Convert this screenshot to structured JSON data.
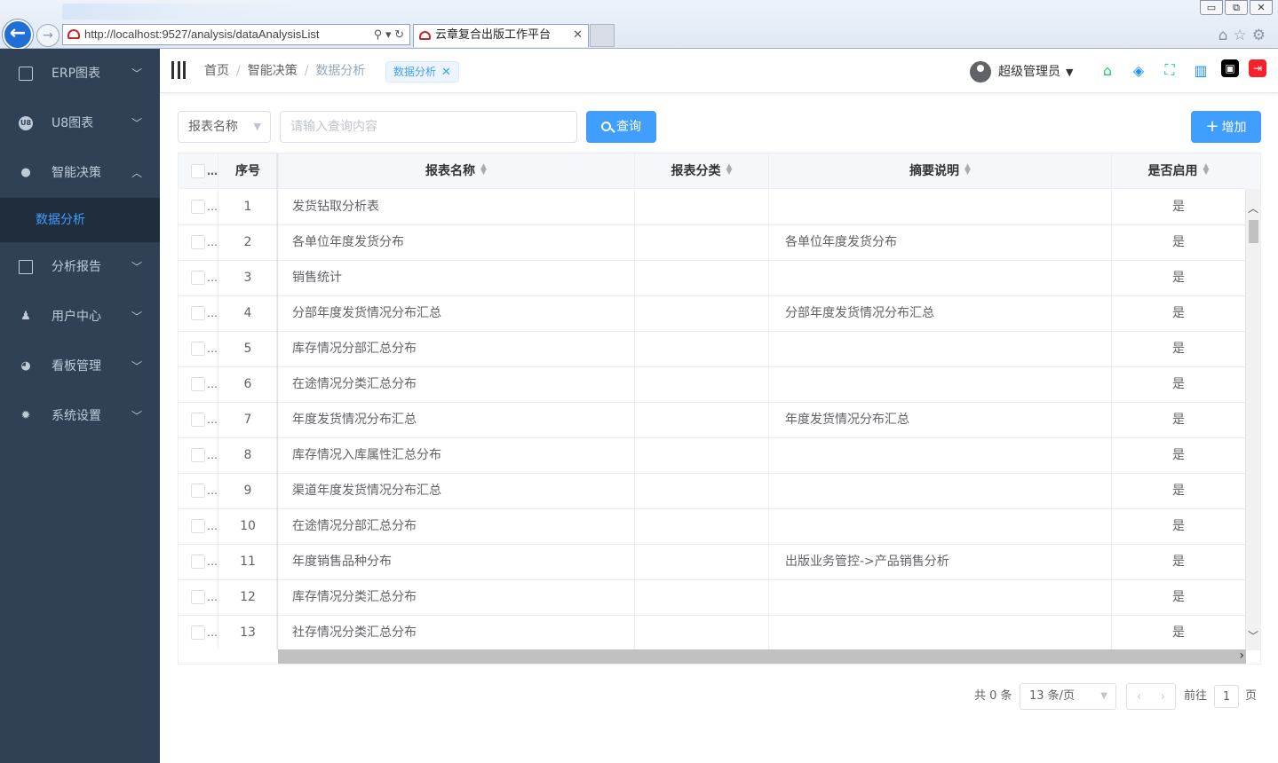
{
  "browser": {
    "url": "http://localhost:9527/analysis/dataAnalysisList",
    "tab_title": "云章复合出版工作平台",
    "tab_close": "✕",
    "win_min": "▭",
    "win_max": "⧉",
    "win_close": "✕"
  },
  "sidebar": {
    "items": [
      {
        "label": "ERP图表",
        "icon": "chart-icon",
        "expanded": false
      },
      {
        "label": "U8图表",
        "icon": "u8-icon",
        "expanded": false
      },
      {
        "label": "智能决策",
        "icon": "brain-icon",
        "expanded": true
      },
      {
        "label": "分析报告",
        "icon": "report-icon",
        "expanded": false
      },
      {
        "label": "用户中心",
        "icon": "user-icon",
        "expanded": false
      },
      {
        "label": "看板管理",
        "icon": "dashboard-icon",
        "expanded": false
      },
      {
        "label": "系统设置",
        "icon": "gear-icon",
        "expanded": false
      }
    ],
    "active_sub": "数据分析"
  },
  "navbar": {
    "breadcrumb": [
      "首页",
      "智能决策",
      "数据分析"
    ],
    "tag": "数据分析",
    "user": "超级管理员"
  },
  "filter": {
    "select_value": "报表名称",
    "search_placeholder": "请输入查询内容",
    "search_button": "查询",
    "add_button": "增加"
  },
  "table": {
    "columns": [
      "序号",
      "报表名称",
      "报表分类",
      "摘要说明",
      "是否启用"
    ],
    "rows": [
      {
        "no": "1",
        "name": "发货钻取分析表",
        "category": "",
        "summary": "",
        "enabled": "是"
      },
      {
        "no": "2",
        "name": "各单位年度发货分布",
        "category": "",
        "summary": "各单位年度发货分布",
        "enabled": "是"
      },
      {
        "no": "3",
        "name": "销售统计",
        "category": "",
        "summary": "",
        "enabled": "是"
      },
      {
        "no": "4",
        "name": "分部年度发货情况分布汇总",
        "category": "",
        "summary": "分部年度发货情况分布汇总",
        "enabled": "是"
      },
      {
        "no": "5",
        "name": "库存情况分部汇总分布",
        "category": "",
        "summary": "",
        "enabled": "是"
      },
      {
        "no": "6",
        "name": "在途情况分类汇总分布",
        "category": "",
        "summary": "",
        "enabled": "是"
      },
      {
        "no": "7",
        "name": "年度发货情况分布汇总",
        "category": "",
        "summary": "年度发货情况分布汇总",
        "enabled": "是"
      },
      {
        "no": "8",
        "name": "库存情况入库属性汇总分布",
        "category": "",
        "summary": "",
        "enabled": "是"
      },
      {
        "no": "9",
        "name": "渠道年度发货情况分布汇总",
        "category": "",
        "summary": "",
        "enabled": "是"
      },
      {
        "no": "10",
        "name": "在途情况分部汇总分布",
        "category": "",
        "summary": "",
        "enabled": "是"
      },
      {
        "no": "11",
        "name": "年度销售品种分布",
        "category": "",
        "summary": "出版业务管控->产品销售分析",
        "enabled": "是"
      },
      {
        "no": "12",
        "name": "库存情况分类汇总分布",
        "category": "",
        "summary": "",
        "enabled": "是"
      },
      {
        "no": "13",
        "name": "社存情况分类汇总分布",
        "category": "",
        "summary": "",
        "enabled": "是"
      }
    ]
  },
  "pagination": {
    "total": "共 0 条",
    "page_size": "13 条/页",
    "goto": "前往",
    "page": "1",
    "page_suffix": "页"
  }
}
